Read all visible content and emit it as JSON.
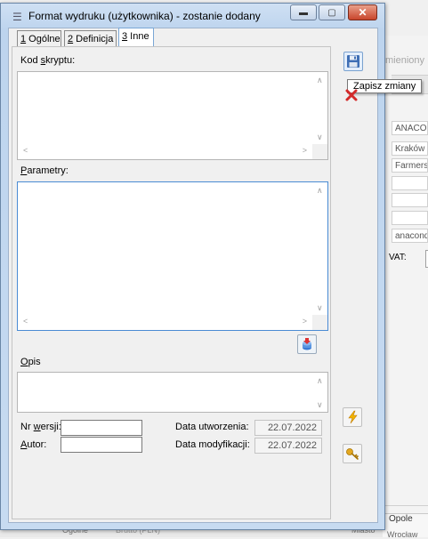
{
  "background_window": {
    "title": "mieniony",
    "fields": [
      "ANACO",
      "Kraków",
      "Farmers",
      "",
      "",
      "",
      "anacond"
    ],
    "vat_label": "VAT:",
    "bottom_city": "Opole",
    "bottom_city2": "Wrocław",
    "strip_cells": [
      "Ogólne",
      "Brutto (PLN)",
      "Miasto"
    ]
  },
  "window": {
    "title": "Format wydruku (użytkownika) - zostanie dodany",
    "icon": "document-icon",
    "close_glyph": "✕",
    "max_glyph": "▢",
    "min_glyph": "▬"
  },
  "tabs": [
    {
      "num": "1",
      "label": " Ogólne"
    },
    {
      "num": "2",
      "label": " Definicja"
    },
    {
      "num": "3",
      "label": " Inne"
    }
  ],
  "toolbar": {
    "save_tooltip": "Zapisz zmiany",
    "save_icon": "floppy-disk-icon",
    "cancel_icon": "cancel-icon",
    "lightning_icon": "lightning-icon",
    "key_icon": "key-icon"
  },
  "form": {
    "script_label_pre": "Kod ",
    "script_label_u": "s",
    "script_label_post": "kryptu:",
    "params_label_u": "P",
    "params_label_post": "arametry:",
    "desc_label_u": "O",
    "desc_label_post": "pis",
    "version_label_pre": "Nr ",
    "version_label_u": "w",
    "version_label_post": "ersji:",
    "version_value": "",
    "author_label_u": "A",
    "author_label_post": "utor:",
    "author_value": "",
    "created_label": "Data utworzenia:",
    "created_value": "22.07.2022",
    "modified_label": "Data modyfikacji:",
    "modified_value": "22.07.2022"
  }
}
